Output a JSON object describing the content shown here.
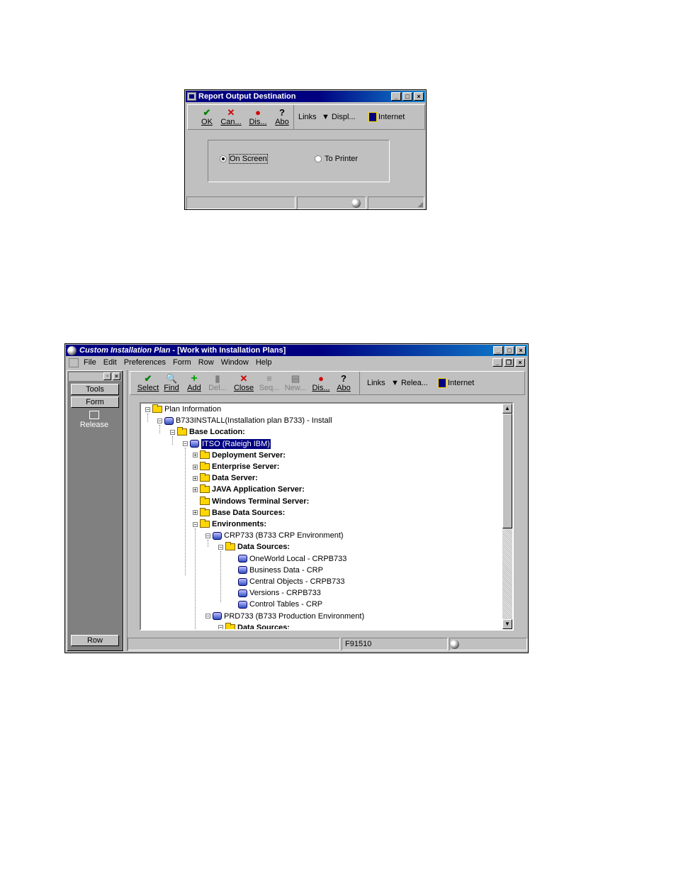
{
  "dialog": {
    "title": "Report Output Destination",
    "toolbar": {
      "buttons": [
        {
          "label": "OK",
          "icon": "checkmark-icon"
        },
        {
          "label": "Can...",
          "icon": "x-icon"
        },
        {
          "label": "Dis...",
          "icon": "display-icon"
        },
        {
          "label": "Abo",
          "icon": "about-icon"
        }
      ],
      "links_label": "Links",
      "display_label": "Displ...",
      "internet_label": "Internet"
    },
    "options": {
      "on_screen": "On Screen",
      "to_printer": "To Printer",
      "selected": "On Screen"
    }
  },
  "main_window": {
    "title_app": "Custom Installation Plan",
    "title_form": " - [Work with Installation Plans]",
    "menu": [
      "File",
      "Edit",
      "Preferences",
      "Form",
      "Row",
      "Window",
      "Help"
    ],
    "side_panel": {
      "tools_label": "Tools",
      "form_label": "Form",
      "release_label": "Release",
      "row_label": "Row"
    },
    "toolbar": {
      "buttons": [
        {
          "label": "Select",
          "enabled": true
        },
        {
          "label": "Find",
          "enabled": true
        },
        {
          "label": "Add",
          "enabled": true
        },
        {
          "label": "Del...",
          "enabled": false
        },
        {
          "label": "Close",
          "enabled": true
        },
        {
          "label": "Seq...",
          "enabled": false
        },
        {
          "label": "New...",
          "enabled": false
        },
        {
          "label": "Dis...",
          "enabled": true
        },
        {
          "label": "Abo",
          "enabled": true
        }
      ],
      "links_label": "Links",
      "release_label": "Relea...",
      "internet_label": "Internet"
    },
    "tree": [
      {
        "label": "Plan Information",
        "level": 0,
        "icon": "folder",
        "bold": false
      },
      {
        "label": "B733INSTALL(Installation plan B733) - Install",
        "level": 1,
        "icon": "db",
        "bold": false
      },
      {
        "label": "Base Location:",
        "level": 2,
        "icon": "folder",
        "bold": true
      },
      {
        "label": "ITSO (Raleigh IBM)",
        "level": 3,
        "icon": "db",
        "bold": false,
        "selected": true
      },
      {
        "label": "Deployment Server:",
        "level": 4,
        "icon": "folder",
        "bold": true
      },
      {
        "label": "Enterprise Server:",
        "level": 4,
        "icon": "folder",
        "bold": true
      },
      {
        "label": "Data Server:",
        "level": 4,
        "icon": "folder",
        "bold": true
      },
      {
        "label": "JAVA Application Server:",
        "level": 4,
        "icon": "folder",
        "bold": true
      },
      {
        "label": "Windows Terminal Server:",
        "level": 4,
        "icon": "folder",
        "bold": true
      },
      {
        "label": "Base Data Sources:",
        "level": 4,
        "icon": "folder",
        "bold": true
      },
      {
        "label": "Environments:",
        "level": 4,
        "icon": "folder",
        "bold": true
      },
      {
        "label": "CRP733 (B733 CRP Environment)",
        "level": 5,
        "icon": "db",
        "bold": false
      },
      {
        "label": "Data Sources:",
        "level": 6,
        "icon": "folder",
        "bold": true
      },
      {
        "label": "OneWorld Local - CRPB733",
        "level": 7,
        "icon": "db",
        "bold": false
      },
      {
        "label": "Business Data - CRP",
        "level": 7,
        "icon": "db",
        "bold": false
      },
      {
        "label": "Central Objects - CRPB733",
        "level": 7,
        "icon": "db",
        "bold": false
      },
      {
        "label": "Versions - CRPB733",
        "level": 7,
        "icon": "db",
        "bold": false
      },
      {
        "label": "Control Tables - CRP",
        "level": 7,
        "icon": "db",
        "bold": false
      },
      {
        "label": "PRD733 (B733 Production Environment)",
        "level": 5,
        "icon": "db",
        "bold": false
      },
      {
        "label": "Data Sources:",
        "level": 6,
        "icon": "folder",
        "bold": true
      }
    ],
    "status": {
      "form_id": "F91510"
    }
  }
}
